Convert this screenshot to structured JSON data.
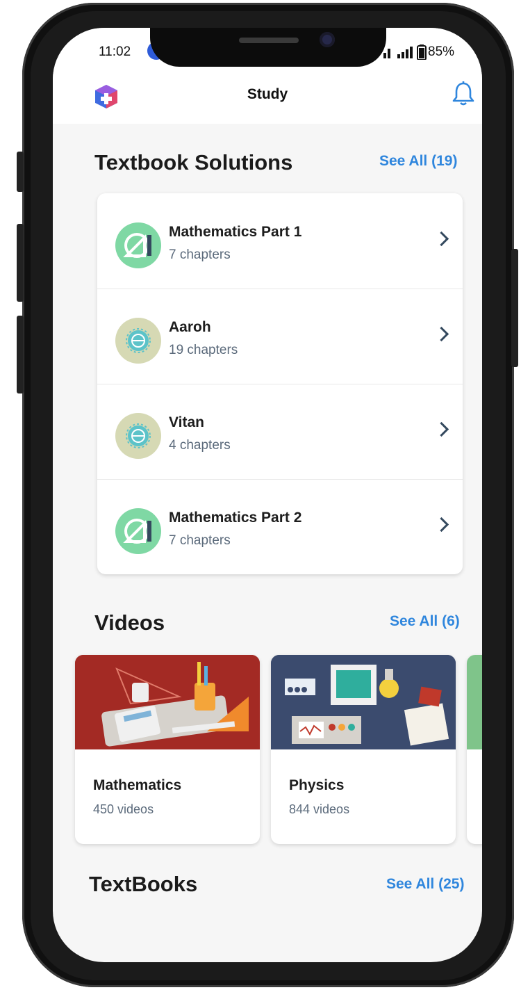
{
  "status_bar": {
    "time": "11:02",
    "battery": "85%"
  },
  "app_bar": {
    "title": "Study"
  },
  "textbook_solutions": {
    "title": "Textbook Solutions",
    "see_all": "See All (19)",
    "items": [
      {
        "title": "Mathematics Part 1",
        "subtitle": "7 chapters",
        "icon": "geometry-icon"
      },
      {
        "title": "Aaroh",
        "subtitle": "19 chapters",
        "icon": "hindi-emblem-icon"
      },
      {
        "title": "Vitan",
        "subtitle": "4 chapters",
        "icon": "hindi-emblem-icon"
      },
      {
        "title": "Mathematics Part 2",
        "subtitle": "7 chapters",
        "icon": "geometry-icon"
      }
    ]
  },
  "videos": {
    "title": "Videos",
    "see_all": "See All (6)",
    "items": [
      {
        "title": "Mathematics",
        "subtitle": "450 videos"
      },
      {
        "title": "Physics",
        "subtitle": "844 videos"
      }
    ]
  },
  "textbooks": {
    "title": "TextBooks",
    "see_all": "See All (25)"
  },
  "colors": {
    "accent": "#2f86dd",
    "math_icon": "#7fd8a4",
    "hindi_icon": "#d6d9b4",
    "math_thumb": "#a32a24",
    "physics_thumb": "#3b4b6e"
  }
}
